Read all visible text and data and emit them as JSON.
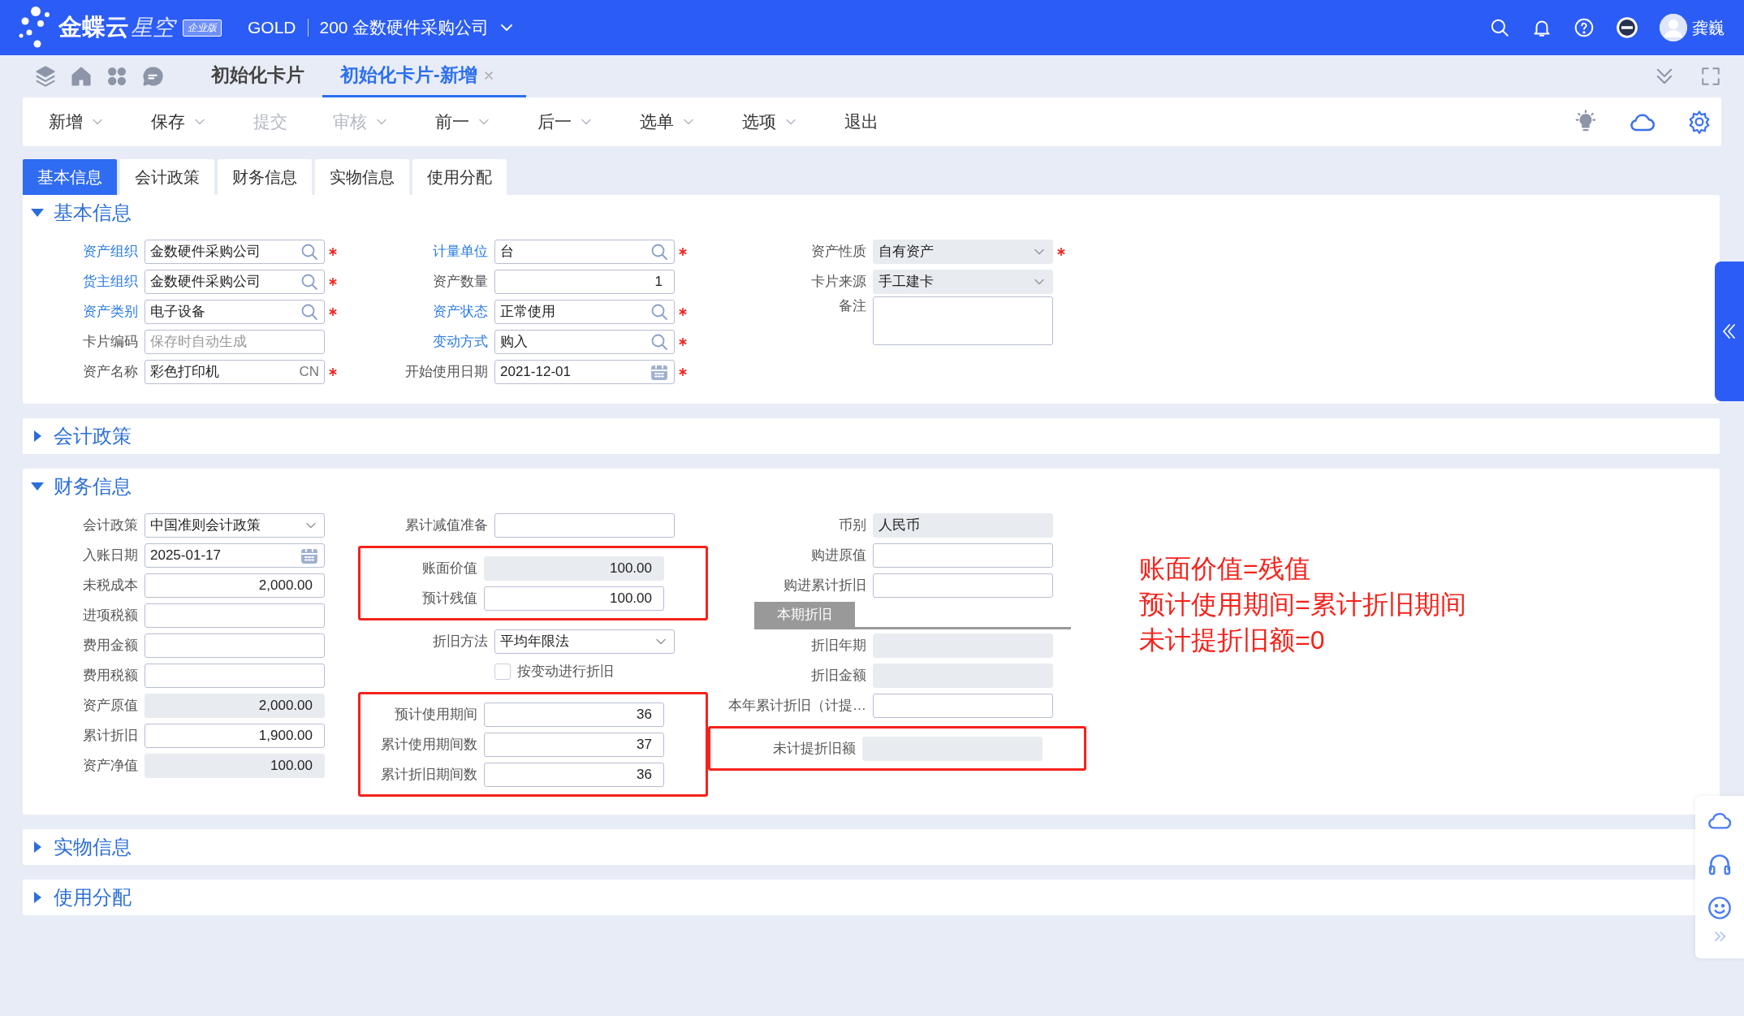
{
  "header": {
    "brand": "金蝶云",
    "product": "星空",
    "edition": "企业版",
    "account": "GOLD",
    "organization": "200 金数硬件采购公司",
    "user": "龚巍"
  },
  "page_tabs": [
    {
      "label": "初始化卡片",
      "selected": false,
      "closable": false
    },
    {
      "label": "初始化卡片-新增",
      "selected": true,
      "closable": true
    }
  ],
  "toolbar": [
    {
      "label": "新增",
      "disabled": false,
      "dropdown": true
    },
    {
      "label": "保存",
      "disabled": false,
      "dropdown": true
    },
    {
      "label": "提交",
      "disabled": true,
      "dropdown": false
    },
    {
      "label": "审核",
      "disabled": true,
      "dropdown": true
    },
    {
      "label": "前一",
      "disabled": false,
      "dropdown": true
    },
    {
      "label": "后一",
      "disabled": false,
      "dropdown": true
    },
    {
      "label": "选单",
      "disabled": false,
      "dropdown": true
    },
    {
      "label": "选项",
      "disabled": false,
      "dropdown": true
    },
    {
      "label": "退出",
      "disabled": false,
      "dropdown": false
    }
  ],
  "form_tabs": [
    {
      "label": "基本信息",
      "selected": true
    },
    {
      "label": "会计政策",
      "selected": false
    },
    {
      "label": "财务信息",
      "selected": false
    },
    {
      "label": "实物信息",
      "selected": false
    },
    {
      "label": "使用分配",
      "selected": false
    }
  ],
  "sections": [
    {
      "title": "基本信息",
      "expanded": true,
      "columns": [
        {
          "groups": [
            {
              "highlighted": false,
              "fields": [
                {
                  "kind": "lookup",
                  "label": "资产组织",
                  "link": true,
                  "value": "金数硬件采购公司",
                  "required": true,
                  "readonly": false
                },
                {
                  "kind": "lookup",
                  "label": "货主组织",
                  "link": true,
                  "value": "金数硬件采购公司",
                  "required": true,
                  "readonly": false
                },
                {
                  "kind": "lookup",
                  "label": "资产类别",
                  "link": true,
                  "value": "电子设备",
                  "required": true,
                  "readonly": false
                },
                {
                  "kind": "text",
                  "label": "卡片编码",
                  "link": false,
                  "placeholder": "保存时自动生成",
                  "required": false,
                  "readonly": false
                },
                {
                  "kind": "text",
                  "label": "资产名称",
                  "link": false,
                  "value": "彩色打印机",
                  "suffix": "CN",
                  "required": true,
                  "readonly": false
                }
              ]
            }
          ]
        },
        {
          "groups": [
            {
              "highlighted": false,
              "fields": [
                {
                  "kind": "lookup",
                  "label": "计量单位",
                  "link": true,
                  "value": "台",
                  "required": true,
                  "readonly": false
                },
                {
                  "kind": "number",
                  "label": "资产数量",
                  "link": false,
                  "value": "1",
                  "required": false,
                  "readonly": false
                },
                {
                  "kind": "lookup",
                  "label": "资产状态",
                  "link": true,
                  "value": "正常使用",
                  "required": true,
                  "readonly": false
                },
                {
                  "kind": "lookup",
                  "label": "变动方式",
                  "link": true,
                  "value": "购入",
                  "required": true,
                  "readonly": false
                },
                {
                  "kind": "date",
                  "label": "开始使用日期",
                  "link": false,
                  "value": "2021-12-01",
                  "required": true,
                  "readonly": false
                }
              ]
            }
          ]
        },
        {
          "groups": [
            {
              "highlighted": false,
              "fields": [
                {
                  "kind": "select",
                  "label": "资产性质",
                  "link": false,
                  "value": "自有资产",
                  "required": true,
                  "readonly": true
                },
                {
                  "kind": "select",
                  "label": "卡片来源",
                  "link": false,
                  "value": "手工建卡",
                  "required": false,
                  "readonly": true
                },
                {
                  "kind": "textarea",
                  "label": "备注",
                  "link": false,
                  "required": false,
                  "readonly": false
                }
              ]
            }
          ]
        }
      ]
    },
    {
      "title": "会计政策",
      "expanded": false
    },
    {
      "title": "财务信息",
      "expanded": true,
      "columns": [
        {
          "groups": [
            {
              "highlighted": false,
              "fields": [
                {
                  "kind": "select",
                  "label": "会计政策",
                  "link": false,
                  "value": "中国准则会计政策",
                  "required": false,
                  "readonly": false
                },
                {
                  "kind": "date",
                  "label": "入账日期",
                  "link": false,
                  "value": "2025-01-17",
                  "required": false,
                  "readonly": false
                },
                {
                  "kind": "number",
                  "label": "未税成本",
                  "link": false,
                  "value": "2,000.00",
                  "required": false,
                  "readonly": false
                },
                {
                  "kind": "number",
                  "label": "进项税额",
                  "link": false,
                  "required": false,
                  "readonly": false
                },
                {
                  "kind": "number",
                  "label": "费用金额",
                  "link": false,
                  "required": false,
                  "readonly": false
                },
                {
                  "kind": "number",
                  "label": "费用税额",
                  "link": false,
                  "required": false,
                  "readonly": false
                },
                {
                  "kind": "number",
                  "label": "资产原值",
                  "link": false,
                  "value": "2,000.00",
                  "required": false,
                  "readonly": true
                },
                {
                  "kind": "number",
                  "label": "累计折旧",
                  "link": false,
                  "value": "1,900.00",
                  "required": false,
                  "readonly": false
                },
                {
                  "kind": "number",
                  "label": "资产净值",
                  "link": false,
                  "value": "100.00",
                  "required": false,
                  "readonly": true
                }
              ]
            }
          ]
        },
        {
          "groups": [
            {
              "highlighted": false,
              "fields": [
                {
                  "kind": "number",
                  "label": "累计减值准备",
                  "link": false,
                  "required": false,
                  "readonly": false
                }
              ]
            },
            {
              "highlighted": true,
              "fields": [
                {
                  "kind": "number",
                  "label": "账面价值",
                  "link": false,
                  "value": "100.00",
                  "required": false,
                  "readonly": true
                },
                {
                  "kind": "number",
                  "label": "预计残值",
                  "link": false,
                  "value": "100.00",
                  "required": false,
                  "readonly": false
                }
              ]
            },
            {
              "highlighted": false,
              "fields": [
                {
                  "kind": "select",
                  "label": "折旧方法",
                  "link": false,
                  "value": "平均年限法",
                  "required": false,
                  "readonly": false
                },
                {
                  "kind": "checkbox",
                  "label": "按变动进行折旧",
                  "checked": false
                }
              ]
            },
            {
              "highlighted": true,
              "fields": [
                {
                  "kind": "number",
                  "label": "预计使用期间",
                  "link": false,
                  "value": "36",
                  "required": false,
                  "readonly": false
                },
                {
                  "kind": "number",
                  "label": "累计使用期间数",
                  "link": false,
                  "value": "37",
                  "required": false,
                  "readonly": false
                },
                {
                  "kind": "number",
                  "label": "累计折旧期间数",
                  "link": false,
                  "value": "36",
                  "required": false,
                  "readonly": false
                }
              ]
            }
          ]
        },
        {
          "groups": [
            {
              "highlighted": false,
              "fields": [
                {
                  "kind": "text",
                  "label": "币别",
                  "link": false,
                  "value": "人民币",
                  "required": false,
                  "readonly": true
                },
                {
                  "kind": "number",
                  "label": "购进原值",
                  "link": false,
                  "required": false,
                  "readonly": false
                },
                {
                  "kind": "number",
                  "label": "购进累计折旧",
                  "link": false,
                  "required": false,
                  "readonly": false
                },
                {
                  "kind": "subtab",
                  "label": "本期折旧"
                },
                {
                  "kind": "text",
                  "label": "折旧年期",
                  "link": false,
                  "required": false,
                  "readonly": true
                },
                {
                  "kind": "number",
                  "label": "折旧金额",
                  "link": false,
                  "required": false,
                  "readonly": true
                },
                {
                  "kind": "number",
                  "label": "本年累计折旧（计提…",
                  "link": false,
                  "required": false,
                  "readonly": false
                }
              ]
            },
            {
              "highlighted": true,
              "fields": [
                {
                  "kind": "number",
                  "label": "未计提折旧额",
                  "link": false,
                  "required": false,
                  "readonly": true
                }
              ]
            }
          ]
        }
      ],
      "note_lines": [
        "账面价值=残值",
        "预计使用期间=累计折旧期间",
        "未计提折旧额=0"
      ]
    },
    {
      "title": "实物信息",
      "expanded": false
    },
    {
      "title": "使用分配",
      "expanded": false
    }
  ]
}
